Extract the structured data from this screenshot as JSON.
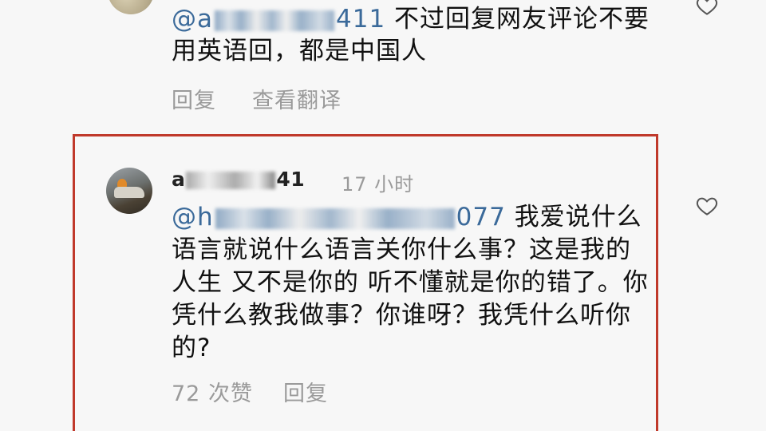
{
  "top_comment": {
    "mention_prefix": "@a",
    "mention_suffix": "411",
    "text": "不过回复网友评论不要用英语回，都是中国人",
    "reply_label": "回复",
    "translate_label": "查看翻译"
  },
  "highlighted_comment": {
    "username_prefix": "a",
    "username_suffix": "41",
    "time": "17 小时",
    "mention_prefix": "@h",
    "mention_suffix": "077",
    "text": "我爱说什么语言就说什么语言关你什么事？这是我的人生 又不是你的 听不懂就是你的错了。你凭什么教我做事？你谁呀？我凭什么听你的?",
    "likes_label": "72 次赞",
    "reply_label": "回复"
  },
  "colors": {
    "highlight_border": "#c0392b",
    "mention": "#3b6a9a",
    "muted_text": "#9a9a9a"
  },
  "icons": {
    "like": "heart-outline-icon"
  }
}
